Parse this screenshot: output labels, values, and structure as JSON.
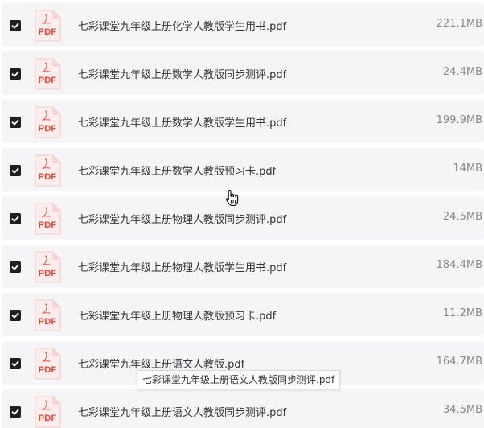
{
  "files": [
    {
      "name": "七彩课堂九年级上册化学人教版学生用书.pdf",
      "size": "221.1MB",
      "checked": true,
      "type_label": "PDF",
      "icon": "pdf-file-icon"
    },
    {
      "name": "七彩课堂九年级上册数学人教版同步测评.pdf",
      "size": "24.4MB",
      "checked": true,
      "type_label": "PDF",
      "icon": "pdf-file-icon"
    },
    {
      "name": "七彩课堂九年级上册数学人教版学生用书.pdf",
      "size": "199.9MB",
      "checked": true,
      "type_label": "PDF",
      "icon": "pdf-file-icon"
    },
    {
      "name": "七彩课堂九年级上册数学人教版预习卡.pdf",
      "size": "14MB",
      "checked": true,
      "type_label": "PDF",
      "icon": "pdf-file-icon"
    },
    {
      "name": "七彩课堂九年级上册物理人教版同步测评.pdf",
      "size": "24.5MB",
      "checked": true,
      "type_label": "PDF",
      "icon": "pdf-file-icon"
    },
    {
      "name": "七彩课堂九年级上册物理人教版学生用书.pdf",
      "size": "184.4MB",
      "checked": true,
      "type_label": "PDF",
      "icon": "pdf-file-icon"
    },
    {
      "name": "七彩课堂九年级上册物理人教版预习卡.pdf",
      "size": "11.2MB",
      "checked": true,
      "type_label": "PDF",
      "icon": "pdf-file-icon"
    },
    {
      "name": "七彩课堂九年级上册语文人教版.pdf",
      "size": "164.7MB",
      "checked": true,
      "type_label": "PDF",
      "icon": "pdf-file-icon"
    },
    {
      "name": "七彩课堂九年级上册语文人教版同步测评.pdf",
      "size": "34.5MB",
      "checked": true,
      "type_label": "PDF",
      "icon": "pdf-file-icon"
    }
  ],
  "tooltip": {
    "text": "七彩课堂九年级上册语文人教版同步测评.pdf"
  },
  "colors": {
    "pdf_red": "#e8453c",
    "row_bg": "#f5f5f7",
    "checkbox": "#1f1f1f"
  },
  "cursor": {
    "icon": "hand-pointer-icon"
  }
}
